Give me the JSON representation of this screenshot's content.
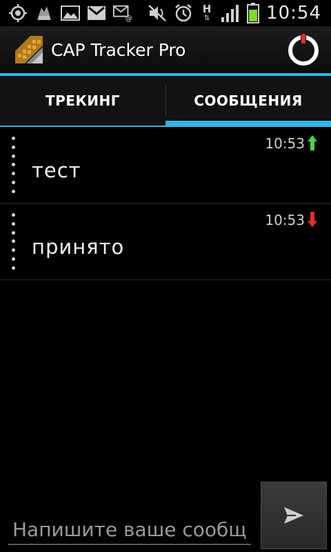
{
  "status_bar": {
    "time": "10:54",
    "network_type": "H",
    "icons": [
      "gps-icon",
      "app-notification-icon",
      "gallery-icon",
      "gmail-icon",
      "email-icon",
      "mute-icon",
      "alarm-icon",
      "network-h-icon",
      "signal-icon",
      "battery-icon"
    ],
    "battery_color": "#7dd92e"
  },
  "action_bar": {
    "title": "CAP Tracker Pro",
    "accent_color": "#33b5e5",
    "power_indicator_color": "#e03030"
  },
  "tabs": [
    {
      "label": "ТРЕКИНГ",
      "active": false
    },
    {
      "label": "СООБЩЕНИЯ",
      "active": true
    }
  ],
  "messages": [
    {
      "time": "10:53",
      "text": "тест",
      "direction": "outgoing",
      "arrow_color": "#4bd24b"
    },
    {
      "time": "10:53",
      "text": "принято",
      "direction": "incoming",
      "arrow_color": "#e03030"
    }
  ],
  "compose": {
    "placeholder": "Напишите ваше сообщение",
    "value": ""
  }
}
